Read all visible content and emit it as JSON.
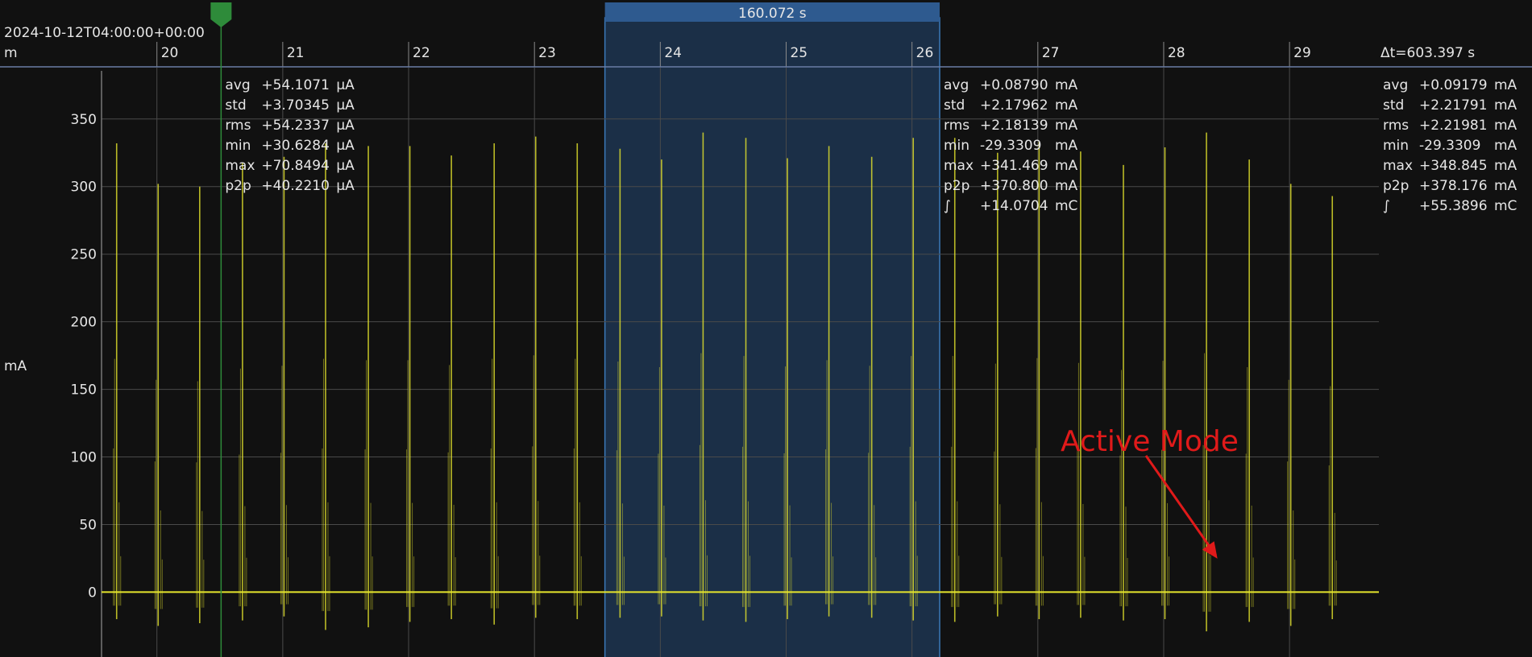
{
  "header": {
    "timestamp": "2024-10-12T04:00:00+00:00",
    "x_unit_prefix": "m",
    "delta_t": "Δt=603.397 s",
    "selection_duration": "160.072 s"
  },
  "colors": {
    "background": "#111111",
    "trace": "#e5e52c",
    "selection_fill": "#1b2f47",
    "selection_border": "#3b79b9",
    "selection_tab": "#2e5a8f",
    "marker": "#2e8b3a",
    "annotation": "#e01a1a",
    "grid": "#4a4a4a"
  },
  "chart_data": {
    "type": "line",
    "xlabel": "",
    "ylabel": "mA",
    "ylim": [
      -48,
      388
    ],
    "xlim": [
      19.56,
      29.71
    ],
    "grid": true,
    "x_ticks": [
      20,
      21,
      22,
      23,
      24,
      25,
      26,
      27,
      28,
      29
    ],
    "y_ticks": [
      0,
      50,
      100,
      150,
      200,
      250,
      300,
      350
    ],
    "series": [
      {
        "x": [
          19.68,
          20.01,
          20.34,
          20.68,
          21.01,
          21.34,
          21.68,
          22.01,
          22.34,
          22.68,
          23.01,
          23.34,
          23.68,
          24.01,
          24.34,
          24.68,
          25.01,
          25.34,
          25.68,
          26.01,
          26.34,
          26.68,
          27.01,
          27.34,
          27.68,
          28.01,
          28.34,
          28.68,
          29.01,
          29.34
        ],
        "values": [
          332,
          302,
          300,
          318,
          322,
          332,
          330,
          330,
          323,
          332,
          337,
          332,
          328,
          320,
          340,
          336,
          321,
          330,
          322,
          336,
          336,
          325,
          333,
          326,
          316,
          329,
          340,
          320,
          302,
          293
        ],
        "min_values": [
          -20,
          -25,
          -23,
          -21,
          -18,
          -28,
          -26,
          -22,
          -20,
          -24,
          -19,
          -20,
          -19,
          -18,
          -21,
          -22,
          -20,
          -18,
          -19,
          -21,
          -22,
          -18,
          -20,
          -19,
          -21,
          -20,
          -29,
          -22,
          -25,
          -20
        ]
      }
    ],
    "marker_x": 20.51,
    "selection_x": [
      23.56,
      26.22
    ],
    "annotations": [
      {
        "text": "Active Mode",
        "x": 28.44,
        "y": 20
      }
    ]
  },
  "stats": [
    {
      "id": "marker",
      "rows": [
        {
          "key": "avg",
          "value": "+54.1071",
          "unit": "µA"
        },
        {
          "key": "std",
          "value": "+3.70345",
          "unit": "µA"
        },
        {
          "key": "rms",
          "value": "+54.2337",
          "unit": "µA"
        },
        {
          "key": "min",
          "value": "+30.6284",
          "unit": "µA"
        },
        {
          "key": "max",
          "value": "+70.8494",
          "unit": "µA"
        },
        {
          "key": "p2p",
          "value": "+40.2210",
          "unit": "µA"
        }
      ]
    },
    {
      "id": "selection",
      "rows": [
        {
          "key": "avg",
          "value": "+0.08790",
          "unit": "mA"
        },
        {
          "key": "std",
          "value": "+2.17962",
          "unit": "mA"
        },
        {
          "key": "rms",
          "value": "+2.18139",
          "unit": "mA"
        },
        {
          "key": "min",
          "value": "-29.3309",
          "unit": "mA"
        },
        {
          "key": "max",
          "value": "+341.469",
          "unit": "mA"
        },
        {
          "key": "p2p",
          "value": "+370.800",
          "unit": "mA"
        },
        {
          "key": "∫",
          "value": "+14.0704",
          "unit": "mC"
        }
      ]
    },
    {
      "id": "total",
      "rows": [
        {
          "key": "avg",
          "value": "+0.09179",
          "unit": "mA"
        },
        {
          "key": "std",
          "value": "+2.21791",
          "unit": "mA"
        },
        {
          "key": "rms",
          "value": "+2.21981",
          "unit": "mA"
        },
        {
          "key": "min",
          "value": "-29.3309",
          "unit": "mA"
        },
        {
          "key": "max",
          "value": "+348.845",
          "unit": "mA"
        },
        {
          "key": "p2p",
          "value": "+378.176",
          "unit": "mA"
        },
        {
          "key": "∫",
          "value": "+55.3896",
          "unit": "mC"
        }
      ]
    }
  ]
}
